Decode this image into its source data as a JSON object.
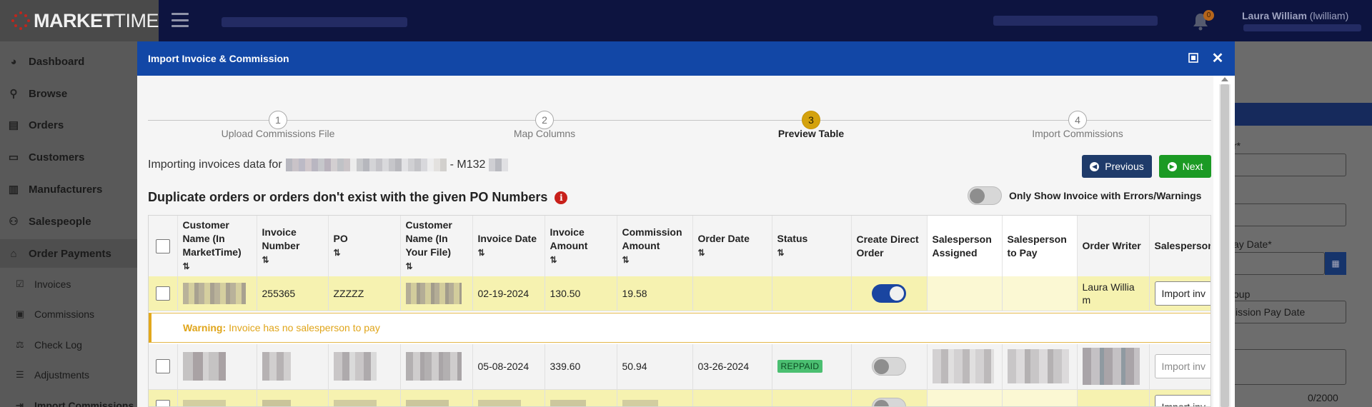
{
  "app": {
    "logo_bold": "MARKET",
    "logo_light": "TIME",
    "user_name": "Laura William",
    "user_handle": "(lwilliam)",
    "notification_count": "0"
  },
  "sidebar": {
    "items": [
      {
        "label": "Dashboard",
        "icon": "palette-icon"
      },
      {
        "label": "Browse",
        "icon": "search-icon"
      },
      {
        "label": "Orders",
        "icon": "document-icon"
      },
      {
        "label": "Customers",
        "icon": "id-card-icon"
      },
      {
        "label": "Manufacturers",
        "icon": "building-icon"
      },
      {
        "label": "Salespeople",
        "icon": "users-icon"
      },
      {
        "label": "Order Payments",
        "icon": "bank-icon"
      }
    ],
    "subitems": [
      {
        "label": "Invoices",
        "icon": "check-square-icon"
      },
      {
        "label": "Commissions",
        "icon": "money-icon"
      },
      {
        "label": "Check Log",
        "icon": "scale-icon"
      },
      {
        "label": "Adjustments",
        "icon": "list-icon"
      },
      {
        "label": "Import Commissions",
        "icon": "import-icon"
      }
    ]
  },
  "right_panel": {
    "field1_label": "r*",
    "field3_label": "ay Date*",
    "field4_label": "oup",
    "field4_value": "ission Pay Date",
    "counter": "0/2000"
  },
  "modal": {
    "title": "Import Invoice & Commission",
    "steps": [
      {
        "number": "1",
        "label": "Upload Commissions File"
      },
      {
        "number": "2",
        "label": "Map Columns"
      },
      {
        "number": "3",
        "label": "Preview Table"
      },
      {
        "number": "4",
        "label": "Import Commissions"
      }
    ],
    "active_step": 3,
    "importing_prefix": "Importing invoices data for",
    "importing_suffix": "- M132",
    "previous_label": "Previous",
    "next_label": "Next",
    "section_title": "Duplicate orders or orders don't exist with the given PO Numbers",
    "toggle_label": "Only Show Invoice with Errors/Warnings",
    "table": {
      "columns": [
        "Customer Name (In MarketTime)",
        "Invoice Number",
        "PO",
        "Customer Name (In Your File)",
        "Invoice Date",
        "Invoice Amount",
        "Commission Amount",
        "Order Date",
        "Status",
        "Create Direct Order",
        "Salesperson Assigned",
        "Salesperson to Pay",
        "Order Writer",
        "Salesperson"
      ],
      "rows": [
        {
          "invoice_number": "255365",
          "po": "ZZZZZ",
          "invoice_date": "02-19-2024",
          "invoice_amount": "130.50",
          "commission_amount": "19.58",
          "order_date": "",
          "status": "",
          "create_direct_order": true,
          "order_writer": "Laura Willia m",
          "action": "Import inv"
        },
        {
          "invoice_number": "",
          "po": "",
          "invoice_date": "05-08-2024",
          "invoice_amount": "339.60",
          "commission_amount": "50.94",
          "order_date": "03-26-2024",
          "status": "REPPAID",
          "create_direct_order": false,
          "order_writer": "",
          "action": "Import inv"
        },
        {
          "invoice_number": "",
          "po": "",
          "invoice_date": "",
          "invoice_amount": "",
          "commission_amount": "",
          "order_date": "",
          "status": "",
          "create_direct_order": false,
          "order_writer": "",
          "action": "Import inv"
        }
      ],
      "warning": {
        "label": "Warning:",
        "message": "Invoice has no salesperson to pay"
      },
      "sort_glyph": "⇅"
    }
  }
}
